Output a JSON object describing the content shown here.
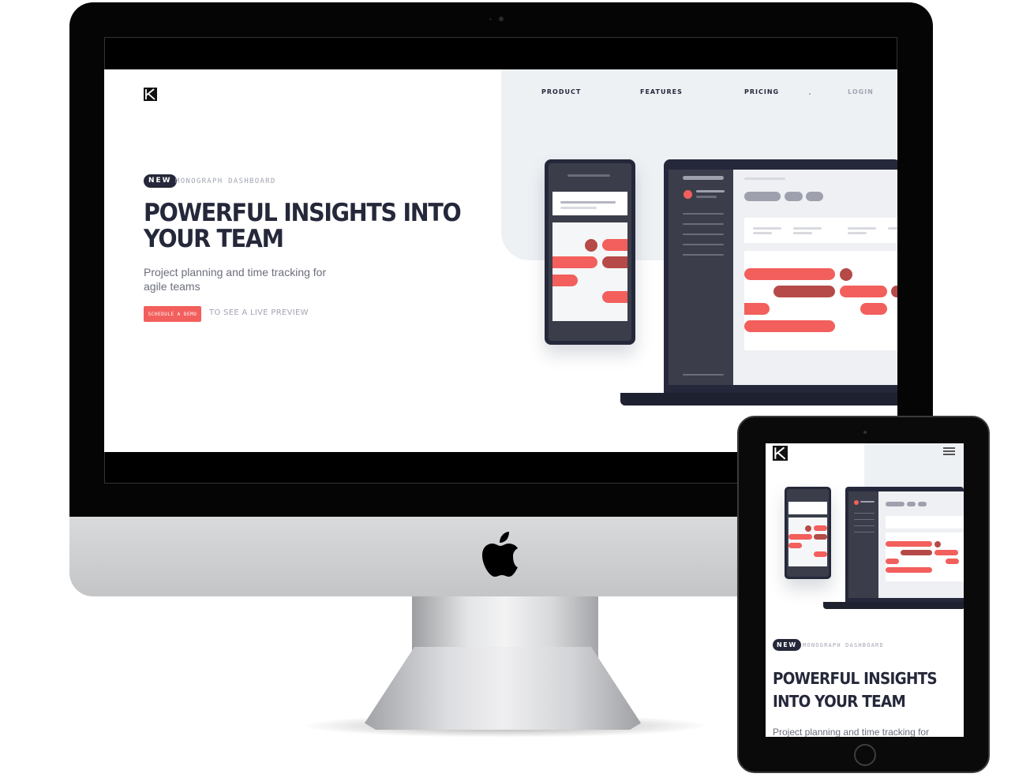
{
  "brand": {
    "logo_icon": "monograph-logo-icon"
  },
  "nav": {
    "items": [
      {
        "label": "PRODUCT"
      },
      {
        "label": "FEATURES"
      },
      {
        "label": "PRICING"
      },
      {
        "label": "LOGIN"
      }
    ]
  },
  "hero": {
    "badge": "NEW",
    "tagline": "MONOGRAPH DASHBOARD",
    "headline": "POWERFUL INSIGHTS INTO YOUR TEAM",
    "subline": "Project planning and time tracking for agile teams",
    "cta_label": "SCHEDULE A DEMO",
    "cta_note": "TO SEE A LIVE PREVIEW"
  },
  "tablet": {
    "badge": "NEW",
    "tagline": "MONOGRAPH DASHBOARD",
    "headline": "POWERFUL INSIGHTS INTO YOUR TEAM",
    "subline": "Project planning and time tracking for",
    "menu_icon": "hamburger-menu-icon"
  },
  "colors": {
    "accent": "#f25f5c",
    "accent_dark": "#b54a48",
    "ink": "#25283a",
    "muted": "#a2a5b3",
    "hero_bg": "#eef1f4"
  }
}
